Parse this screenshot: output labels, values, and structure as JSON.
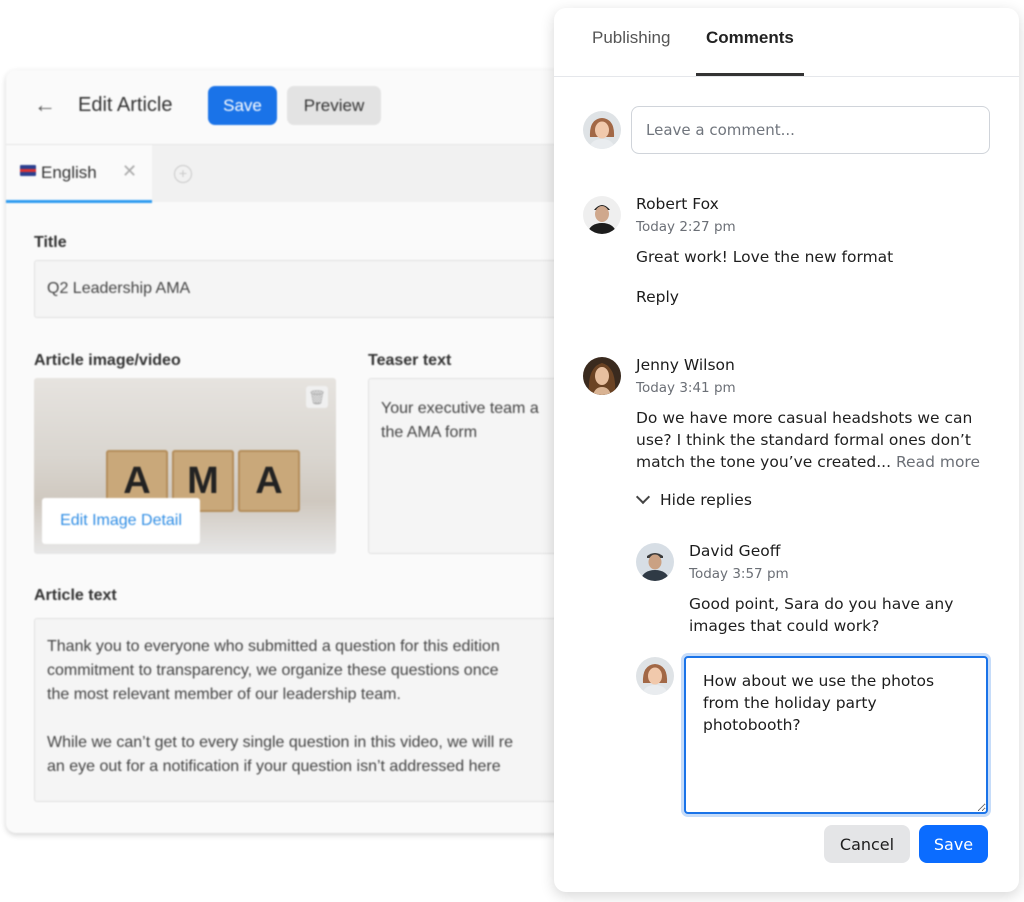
{
  "editor": {
    "back_icon": "arrow-left-icon",
    "title": "Edit Article",
    "save_label": "Save",
    "preview_label": "Preview",
    "tab_label": "English",
    "tab_close": "✕",
    "add_tab": "+",
    "title_label": "Title",
    "title_value": "Q2 Leadership AMA",
    "image_label": "Article image/video",
    "image_text": [
      "A",
      "M",
      "A"
    ],
    "edit_image_label": "Edit Image Detail",
    "teaser_label": "Teaser text",
    "teaser_value": "Your executive team a\nthe AMA form",
    "article_label": "Article text",
    "article_p1": "Thank you to everyone who submitted a question for this edition\ncommitment to transparency, we organize these questions once\nthe most relevant member of our leadership team.",
    "article_p2": "While we can’t get to every single question in this video, we will re\nan eye out for a notification if your question isn’t addressed here"
  },
  "panel": {
    "tabs": [
      {
        "label": "Publishing"
      },
      {
        "label": "Comments",
        "active": true
      }
    ],
    "input_placeholder": "Leave a comment...",
    "comments": [
      {
        "name": "Robert Fox",
        "time": "Today 2:27 pm",
        "body": "Great work! Love the new format",
        "reply_label": "Reply"
      },
      {
        "name": "Jenny Wilson",
        "time": "Today 3:41 pm",
        "body": "Do we have more casual headshots we can use? I think the standard formal ones don’t match the tone you’ve created...",
        "read_more": "Read more",
        "hide_replies": "Hide replies",
        "replies": [
          {
            "name": "David Geoff",
            "time": "Today 3:57 pm",
            "body": "Good point, Sara do you have any images that could work?"
          }
        ]
      }
    ],
    "reply_draft": "How about we use the photos from the holiday party photobooth?",
    "cancel_label": "Cancel",
    "save_label": "Save"
  },
  "colors": {
    "accent": "#0b6cff",
    "focus_ring": "#1a73e8",
    "tab_indicator": "#333333"
  }
}
